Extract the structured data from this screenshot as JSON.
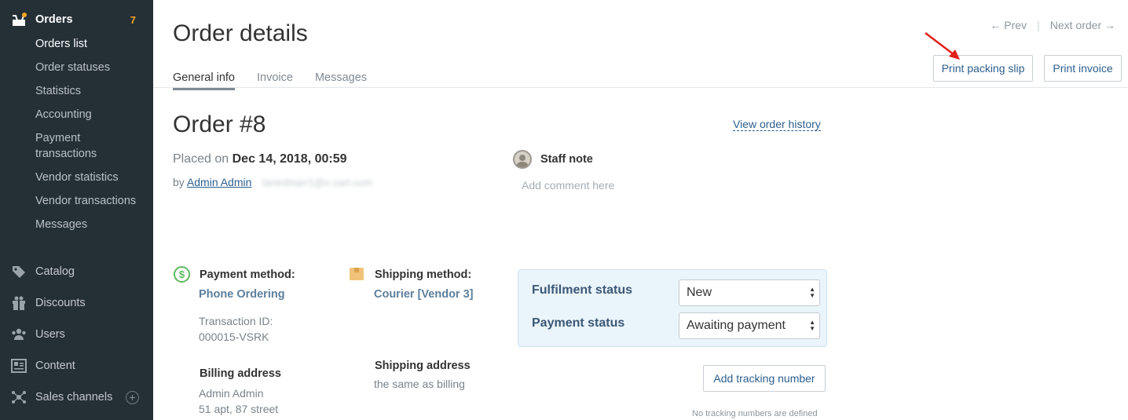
{
  "sidebar": {
    "orders": {
      "label": "Orders",
      "badge": "7"
    },
    "orders_items": [
      {
        "label": "Orders list"
      },
      {
        "label": "Order statuses"
      },
      {
        "label": "Statistics"
      },
      {
        "label": "Accounting"
      },
      {
        "label": "Payment transactions"
      },
      {
        "label": "Vendor statistics"
      },
      {
        "label": "Vendor transactions"
      },
      {
        "label": "Messages"
      }
    ],
    "sections": [
      {
        "label": "Catalog",
        "icon": "tag-icon"
      },
      {
        "label": "Discounts",
        "icon": "gift-icon"
      },
      {
        "label": "Users",
        "icon": "users-icon"
      },
      {
        "label": "Content",
        "icon": "content-icon"
      },
      {
        "label": "Sales channels",
        "icon": "sales-channels-icon",
        "plus": "+"
      }
    ]
  },
  "header": {
    "title": "Order details",
    "tabs": [
      {
        "label": "General info",
        "active": true
      },
      {
        "label": "Invoice",
        "active": false
      },
      {
        "label": "Messages",
        "active": false
      }
    ],
    "prev_label": "← Prev",
    "next_label": "Next order →",
    "print_slip_label": "Print packing slip",
    "print_invoice_label": "Print invoice"
  },
  "order": {
    "title": "Order #8",
    "history_link": "View order history",
    "placed_prefix": "Placed on",
    "placed_date": "Dec 14, 2018, 00:59",
    "by_prefix": "by",
    "by_name": "Admin Admin",
    "email_blurred": "lanedmarr1@x-cart.com"
  },
  "staff_note": {
    "title": "Staff note",
    "placeholder": "Add comment here"
  },
  "payment": {
    "label": "Payment method:",
    "value": "Phone Ordering",
    "transaction_label": "Transaction ID:",
    "transaction_id": "000015-VSRK"
  },
  "shipping": {
    "label": "Shipping method:",
    "value": "Courier [Vendor 3]"
  },
  "billing_address": {
    "label": "Billing address",
    "name": "Admin Admin",
    "line1": "51 apt, 87 street"
  },
  "shipping_address": {
    "label": "Shipping address",
    "value": "the same as billing"
  },
  "statuses": {
    "fulfilment_label": "Fulfilment status",
    "fulfilment_value": "New",
    "payment_label": "Payment status",
    "payment_value": "Awaiting payment"
  },
  "tracking": {
    "button_label": "Add tracking number",
    "empty_text": "No tracking numbers are defined"
  },
  "colors": {
    "sidebar_bg": "#252f36",
    "link": "#2d5f8e",
    "badge": "#f5a623",
    "status_box_bg": "#eaf4fb",
    "annotation_arrow": "#e0201b"
  }
}
